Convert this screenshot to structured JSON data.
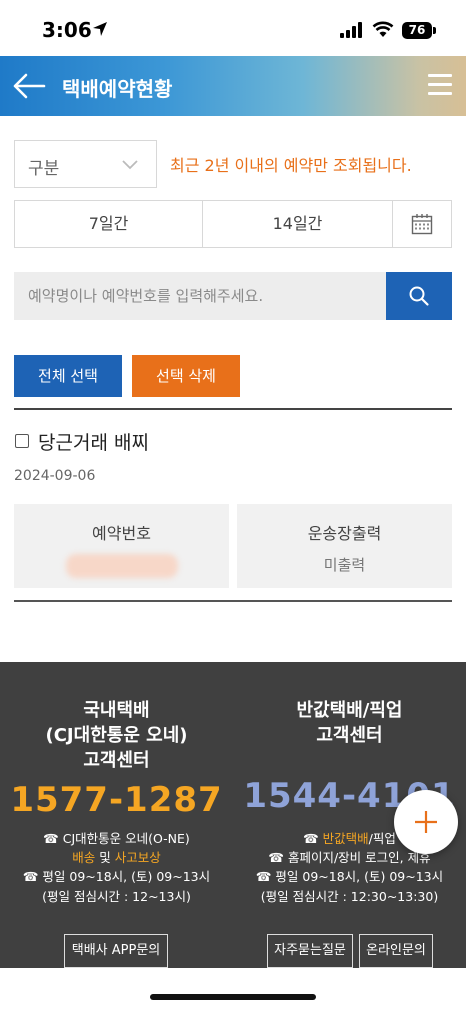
{
  "status": {
    "time": "3:06",
    "battery": "76"
  },
  "header": {
    "title": "택배예약현황"
  },
  "filter": {
    "category_label": "구분",
    "notice": "최근 2년 이내의 예약만 조회됩니다.",
    "period_7": "7일간",
    "period_14": "14일간"
  },
  "search": {
    "placeholder": "예약명이나 예약번호를 입력해주세요."
  },
  "actions": {
    "select_all": "전체 선택",
    "delete_selected": "선택 삭제"
  },
  "reservation": {
    "title": "당근거래 배찌",
    "date": "2024-09-06",
    "number_label": "예약번호",
    "waybill_label": "운송장출력",
    "waybill_value": "미출력"
  },
  "footer": {
    "left": {
      "title_line1": "국내택배",
      "title_line2": "(CJ대한통운 오네)",
      "title_line3": "고객센터",
      "phone": "1577-1287",
      "line1": "☎ CJ대한통운 오네(O-NE)",
      "line2_a": "배송",
      "line2_b": " 및 ",
      "line2_c": "사고보상",
      "line3": "☎ 평일 09~18시, (토) 09~13시",
      "line4": "(평일 점심시간 : 12~13시)",
      "button": "택배사 APP문의"
    },
    "right": {
      "title_line1": "반값택배/픽업",
      "title_line2": "고객센터",
      "phone": "1544-4101",
      "line1_a": "☎ ",
      "line1_b": "반값택배",
      "line1_c": "/픽업",
      "line2": "☎ 홈페이지/장비 로그인, 제휴",
      "line3": "☎ 평일 09~18시, (토) 09~13시",
      "line4": "(평일 점심시간 : 12:30~13:30)",
      "button_faq": "자주묻는질문",
      "button_online": "온라인문의"
    }
  },
  "colors": {
    "primary": "#1e63b5",
    "accent": "#e8701a",
    "footer_bg": "#404040",
    "phone_orange": "#f5a623",
    "phone_blue": "#8fa3d8"
  }
}
